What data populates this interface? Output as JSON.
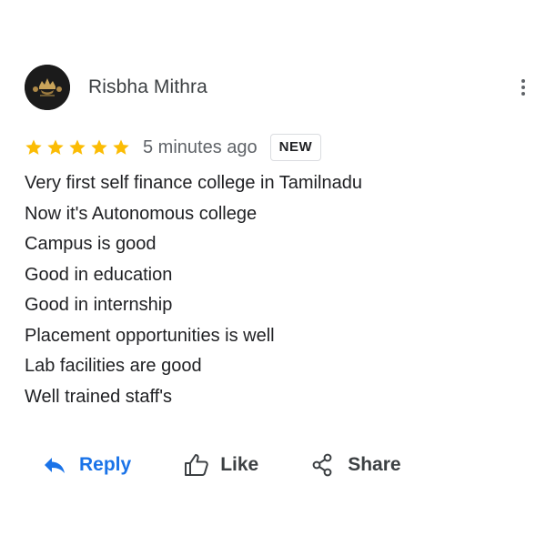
{
  "review": {
    "author": "Risbha Mithra",
    "avatar_icon": "crest-logo-icon",
    "rating": 5,
    "rating_max": 5,
    "star_color": "#fbbc04",
    "time_ago": "5 minutes ago",
    "badge": "NEW",
    "lines": [
      "Very first self finance college in Tamilnadu",
      "Now it's Autonomous college",
      "Campus is good",
      "Good in education",
      "Good in internship",
      "Placement opportunities is well",
      "Lab facilities are good",
      "Well trained staff's"
    ]
  },
  "actions": {
    "reply_label": "Reply",
    "reply_icon": "reply-arrow-icon",
    "like_label": "Like",
    "like_icon": "thumbs-up-icon",
    "share_label": "Share",
    "share_icon": "share-icon",
    "more_icon": "more-vert-icon"
  },
  "colors": {
    "accent": "#1a73e8",
    "star": "#fbbc04",
    "text": "#202124",
    "muted": "#5f6368"
  }
}
